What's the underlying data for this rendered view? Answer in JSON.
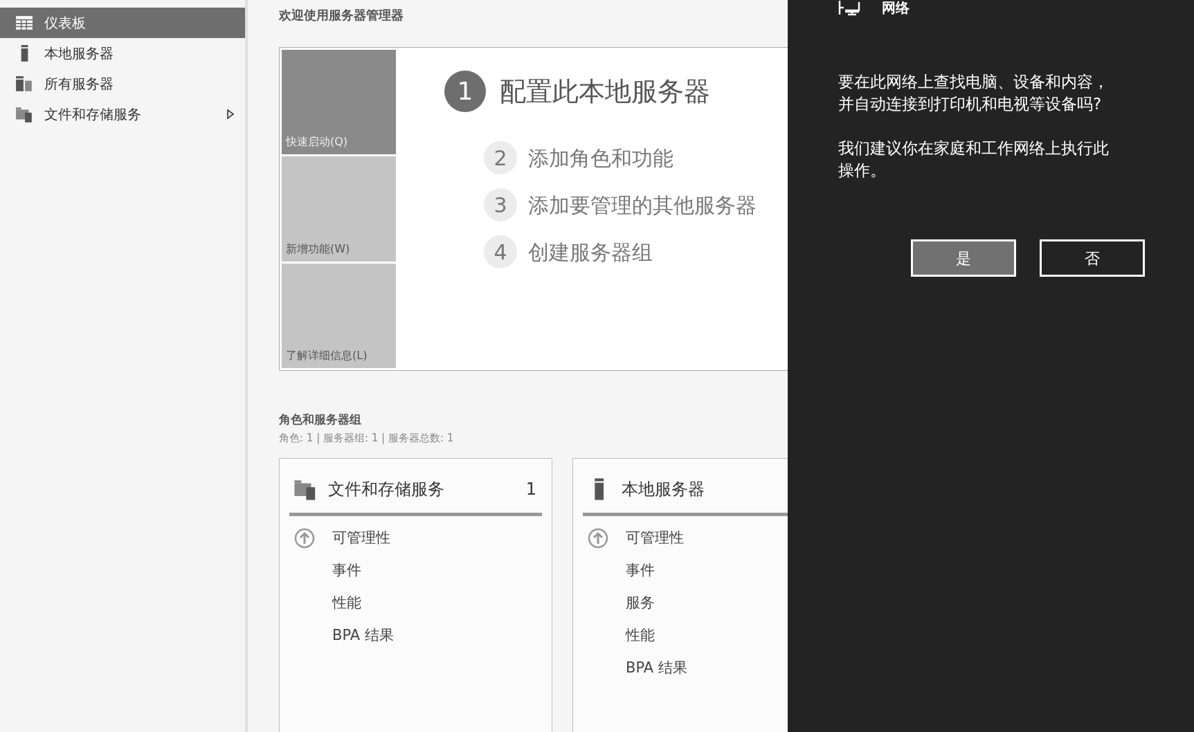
{
  "sidebar": {
    "items": [
      {
        "label": "仪表板",
        "kind": "dashboard",
        "selected": true,
        "expandable": false
      },
      {
        "label": "本地服务器",
        "kind": "server",
        "selected": false,
        "expandable": false
      },
      {
        "label": "所有服务器",
        "kind": "servers",
        "selected": false,
        "expandable": false
      },
      {
        "label": "文件和存储服务",
        "kind": "storage",
        "selected": false,
        "expandable": true
      }
    ]
  },
  "welcome": {
    "title": "欢迎使用服务器管理器",
    "tiles": [
      {
        "label": "快速启动(Q)",
        "selected": true
      },
      {
        "label": "新增功能(W)",
        "selected": false
      },
      {
        "label": "了解详细信息(L)",
        "selected": false
      }
    ],
    "steps": [
      {
        "number": "1",
        "label": "配置此本地服务器",
        "current": true
      },
      {
        "number": "2",
        "label": "添加角色和功能",
        "current": false
      },
      {
        "number": "3",
        "label": "添加要管理的其他服务器",
        "current": false
      },
      {
        "number": "4",
        "label": "创建服务器组",
        "current": false
      }
    ]
  },
  "roles": {
    "heading": "角色和服务器组",
    "summary": "角色: 1 | 服务器组: 1 | 服务器总数: 1",
    "cards": [
      {
        "title": "文件和存储服务",
        "kind": "storage",
        "count": "1",
        "rows": [
          {
            "label": "可管理性",
            "kind": "status"
          },
          {
            "label": "事件",
            "kind": "plain"
          },
          {
            "label": "性能",
            "kind": "plain"
          },
          {
            "label": "BPA 结果",
            "kind": "plain"
          }
        ]
      },
      {
        "title": "本地服务器",
        "kind": "server",
        "rows": [
          {
            "label": "可管理性",
            "kind": "status"
          },
          {
            "label": "事件",
            "kind": "plain"
          },
          {
            "label": "服务",
            "kind": "plain"
          },
          {
            "label": "性能",
            "kind": "plain"
          },
          {
            "label": "BPA 结果",
            "kind": "plain"
          }
        ]
      }
    ]
  },
  "network_panel": {
    "title": "网络",
    "paragraphs": [
      "要在此网络上查找电脑、设备和内容，并自动连接到打印机和电视等设备吗?",
      "我们建议你在家庭和工作网络上执行此操作。"
    ],
    "buttons": [
      {
        "label": "是",
        "selected": true
      },
      {
        "label": "否",
        "selected": false
      }
    ]
  }
}
